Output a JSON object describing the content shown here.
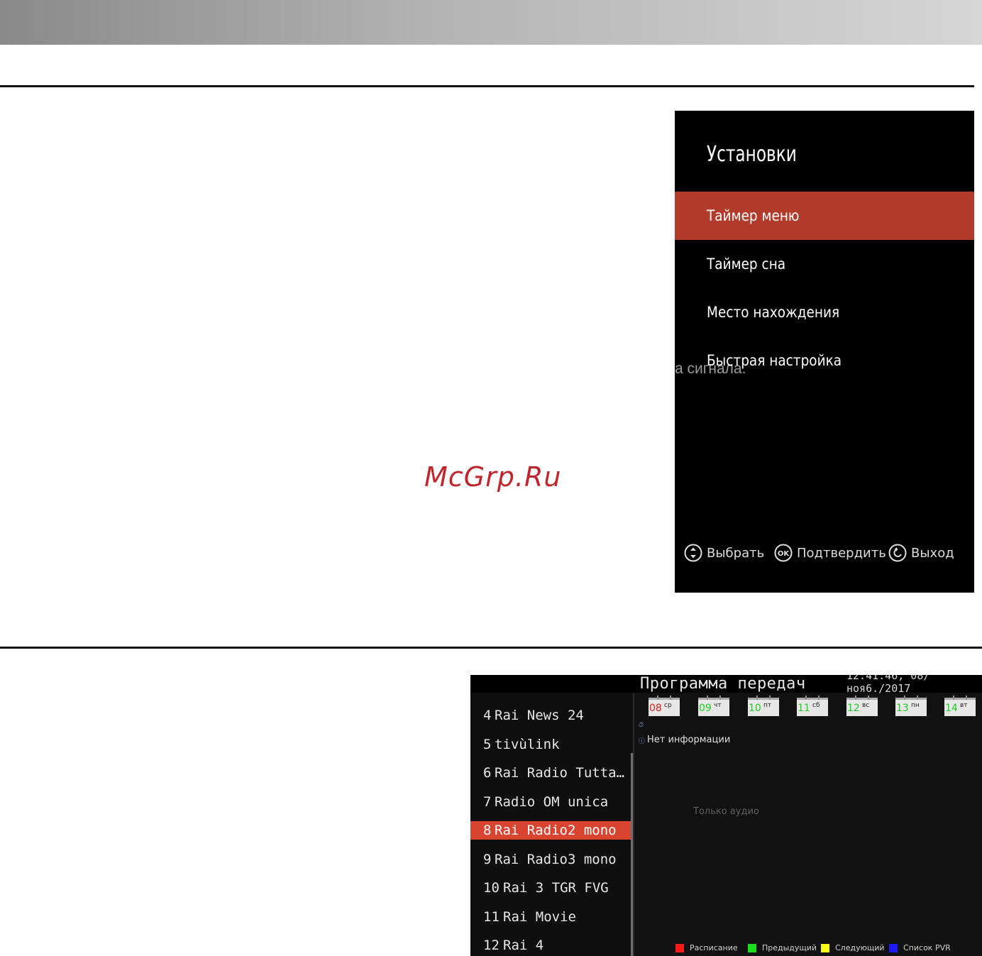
{
  "settings": {
    "title": "Установки",
    "menu": [
      "Таймер меню",
      "Таймер сна",
      "Место нахождения",
      "Быстрая настройка"
    ],
    "bleed_text": "а сигнала.",
    "hints": {
      "select": "Выбрать",
      "ok_icon_text": "OK",
      "confirm": "Подтвердить",
      "exit": "Выход"
    }
  },
  "watermark": "McGrp.Ru",
  "epg": {
    "title": "Программа передач",
    "clock": "12:41:46, 08/ноя6./2017",
    "channels": [
      {
        "num": "4",
        "name": "Rai News 24"
      },
      {
        "num": "5",
        "name": "tivùlink"
      },
      {
        "num": "6",
        "name": "Rai Radio Tutta…"
      },
      {
        "num": "7",
        "name": "Radio OM unica"
      },
      {
        "num": "8",
        "name": "Rai Radio2 mono"
      },
      {
        "num": "9",
        "name": "Rai Radio3 mono"
      },
      {
        "num": "10",
        "name": "Rai 3 TGR FVG"
      },
      {
        "num": "11",
        "name": "Rai Movie"
      },
      {
        "num": "12",
        "name": "Rai 4"
      }
    ],
    "selected_channel_index": 4,
    "days": [
      {
        "num": "08",
        "name": "ср",
        "color": "#e0241f"
      },
      {
        "num": "09",
        "name": "чт",
        "color": "#1fd11f"
      },
      {
        "num": "10",
        "name": "пт",
        "color": "#1fd11f"
      },
      {
        "num": "11",
        "name": "сб",
        "color": "#1fd11f"
      },
      {
        "num": "12",
        "name": "вс",
        "color": "#1fd11f"
      },
      {
        "num": "13",
        "name": "пн",
        "color": "#1fd11f"
      },
      {
        "num": "14",
        "name": "вт",
        "color": "#1fd11f"
      }
    ],
    "no_info": "Нет информации",
    "audio_only": "Только аудио",
    "legend": [
      {
        "label": "Расписание",
        "color": "#ff1a1a"
      },
      {
        "label": "Предыдущий",
        "color": "#19e019"
      },
      {
        "label": "Следующий",
        "color": "#ffff1a"
      },
      {
        "label": "Список PVR",
        "color": "#1a1aff"
      }
    ]
  }
}
